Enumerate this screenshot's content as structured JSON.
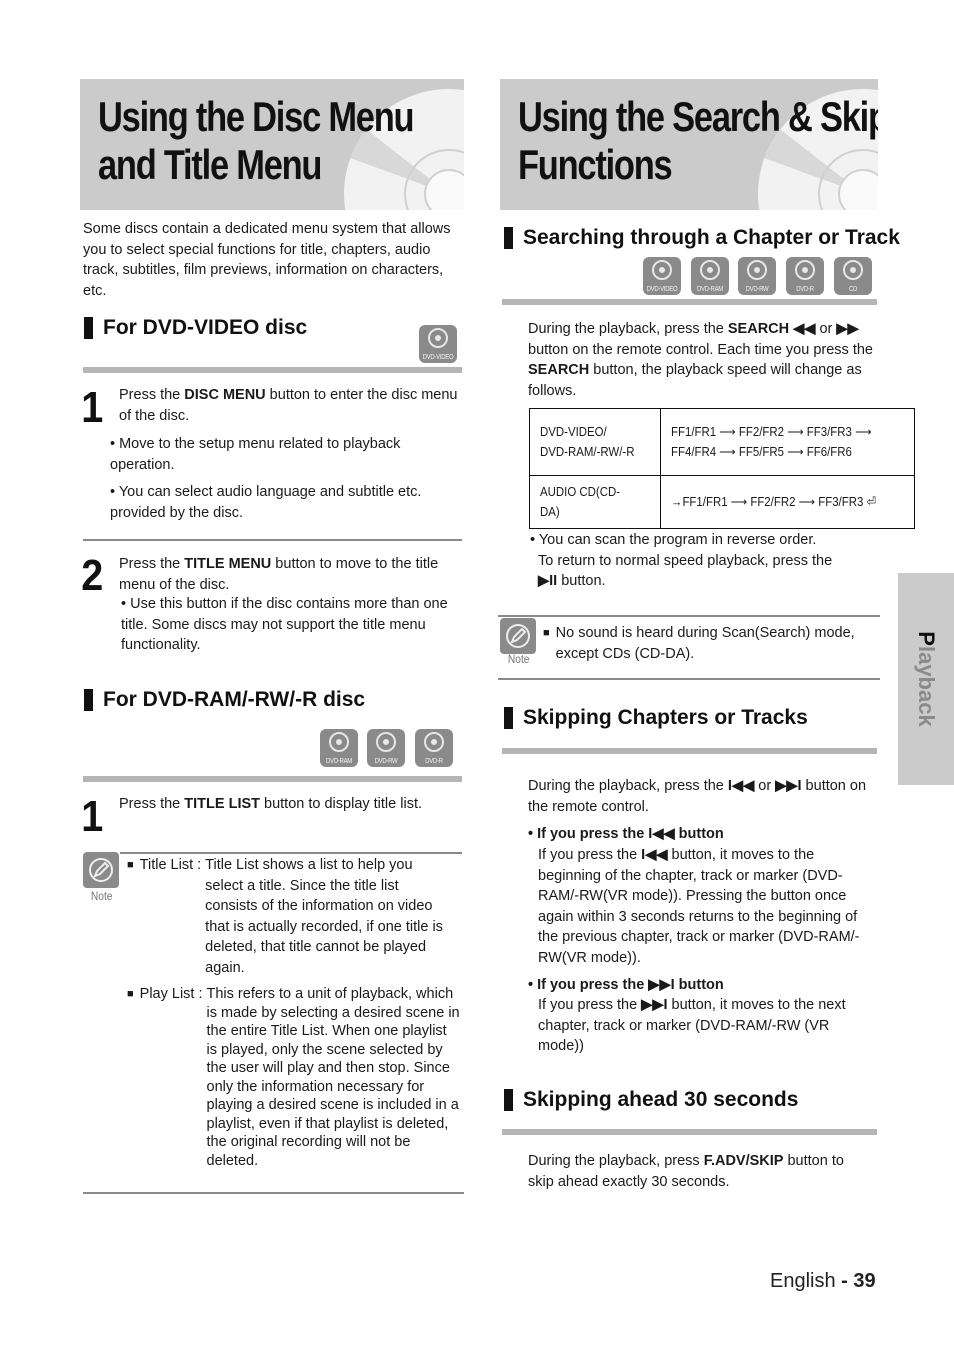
{
  "left": {
    "title_line1": "Using the Disc Menu",
    "title_line2": "and Title Menu",
    "intro": "Some discs contain a dedicated menu system that allows you to select special functions for title, chapters, audio track, subtitles, film previews, information on characters, etc.",
    "dvd_video_section": {
      "heading": "For DVD-VIDEO disc",
      "badge": "DVD-VIDEO",
      "step1_num": "1",
      "step1_pre": "Press the ",
      "step1_bold": "DISC MENU",
      "step1_post": " button to enter the disc menu of the disc.",
      "bullet1": "• Move to the setup menu related to playback operation.",
      "bullet2": "• You can select audio language and subtitle etc. provided by the disc.",
      "step2_num": "2",
      "step2_pre": "Press the ",
      "step2_bold": "TITLE MENU",
      "step2_post": " button to move to the title menu of the disc.",
      "step2_bullet": "• Use this button if the disc contains more than one title. Some discs may not support the title menu functionality."
    },
    "dvd_ram_section": {
      "heading": "For DVD-RAM/-RW/-R disc",
      "badges": [
        "DVD-RAM",
        "DVD-RW",
        "DVD-R"
      ],
      "step1_num": "1",
      "step1_pre": "Press the ",
      "step1_bold": "TITLE LIST",
      "step1_post": " button to display title list.",
      "note_label": "Note",
      "note_items": [
        {
          "term": "Title List :",
          "text": "Title List shows a list to help you select a title. Since the title list consists of the information on video that is actually recorded, if one title is deleted, that title cannot be played again."
        },
        {
          "term": "Play List :",
          "text": "This refers to a unit of playback, which is made by selecting a desired scene in the entire Title List. When one playlist is played, only the scene selected by the user will play and then stop. Since only the information necessary for playing a desired scene is included in a playlist, even if that playlist is deleted, the original recording will not be deleted."
        }
      ]
    }
  },
  "right": {
    "title_line1": "Using the Search & Skip",
    "title_line2": "Functions",
    "search_section": {
      "heading": "Searching through a Chapter or Track",
      "badges": [
        "DVD-VIDEO",
        "DVD-RAM",
        "DVD-RW",
        "DVD-R",
        "CD"
      ],
      "para_pre": "During the playback, press the ",
      "para_bold1": "SEARCH ◀◀",
      "para_mid1": " or ",
      "para_bold2": "▶▶",
      "para_mid2": " button on the remote control. Each time you press the ",
      "para_bold3": "SEARCH",
      "para_post": " button, the playback speed will change as follows.",
      "table": [
        {
          "disc": "DVD-VIDEO/ DVD-RAM/-RW/-R",
          "speeds": "FF1/FR1 ⟶ FF2/FR2 ⟶ FF3/FR3 ⟶ FF4/FR4 ⟶ FF5/FR5 ⟶ FF6/FR6"
        },
        {
          "disc": "AUDIO CD(CD-DA)",
          "speeds": "→FF1/FR1 ⟶ FF2/FR2 ⟶ FF3/FR3 ⏎"
        }
      ],
      "bullet": "• You can scan the program in reverse order.",
      "bullet_cont": "To return to normal speed playback, press the",
      "bullet_btn": "▶II",
      "bullet_end": " button.",
      "note_label": "Note",
      "note_text": "No sound is heard during Scan(Search) mode, except CDs (CD-DA)."
    },
    "skip_section": {
      "heading": "Skipping Chapters or Tracks",
      "para_pre": "During the playback, press the ",
      "para_btn1": "I◀◀",
      "para_mid": " or ",
      "para_btn2": "▶▶I",
      "para_post": " button on the remote control.",
      "sub1_heading": "• If you press the I◀◀ button",
      "sub1_pre": "If you press the ",
      "sub1_btn": "I◀◀",
      "sub1_post": " button, it moves to the beginning of the chapter, track or marker (DVD-RAM/-RW(VR mode)). Pressing the button once again within 3 seconds returns to the beginning of  the previous chapter, track or marker (DVD-RAM/-RW(VR mode)).",
      "sub2_heading": "• If you press the ▶▶I button",
      "sub2_pre": "If you press the ",
      "sub2_btn": "▶▶I",
      "sub2_post": " button, it moves to the next chapter, track or marker (DVD-RAM/-RW (VR mode))"
    },
    "skip30_section": {
      "heading": "Skipping ahead 30 seconds",
      "para_pre": "During the playback, press ",
      "para_bold": "F.ADV/SKIP",
      "para_post": " button to skip ahead exactly 30 seconds."
    }
  },
  "side_tab": "Playback",
  "footer": {
    "lang": "English",
    "sep": " - ",
    "page": "39"
  }
}
